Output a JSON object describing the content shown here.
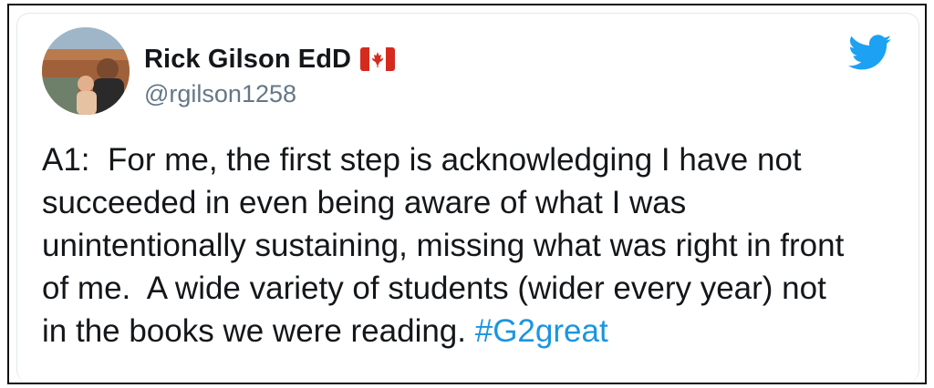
{
  "tweet": {
    "author": {
      "display_name": "Rick Gilson EdD",
      "handle": "@rgilson1258",
      "flag_icon": "canada-flag-icon"
    },
    "platform_icon": "twitter-bird-icon",
    "text_lines": [
      "A1:  For me, the first step is acknowledging I have not",
      "succeeded in even being aware of what I was",
      "unintentionally sustaining, missing what was right in front",
      "of me.  A wide variety of students (wider every year) not",
      "in the books we were reading. "
    ],
    "hashtag": "#G2great"
  },
  "colors": {
    "text": "#14171a",
    "secondary": "#657786",
    "link": "#1b95e0",
    "twitter_blue": "#1da1f2",
    "canada_red": "#d52b1e"
  }
}
